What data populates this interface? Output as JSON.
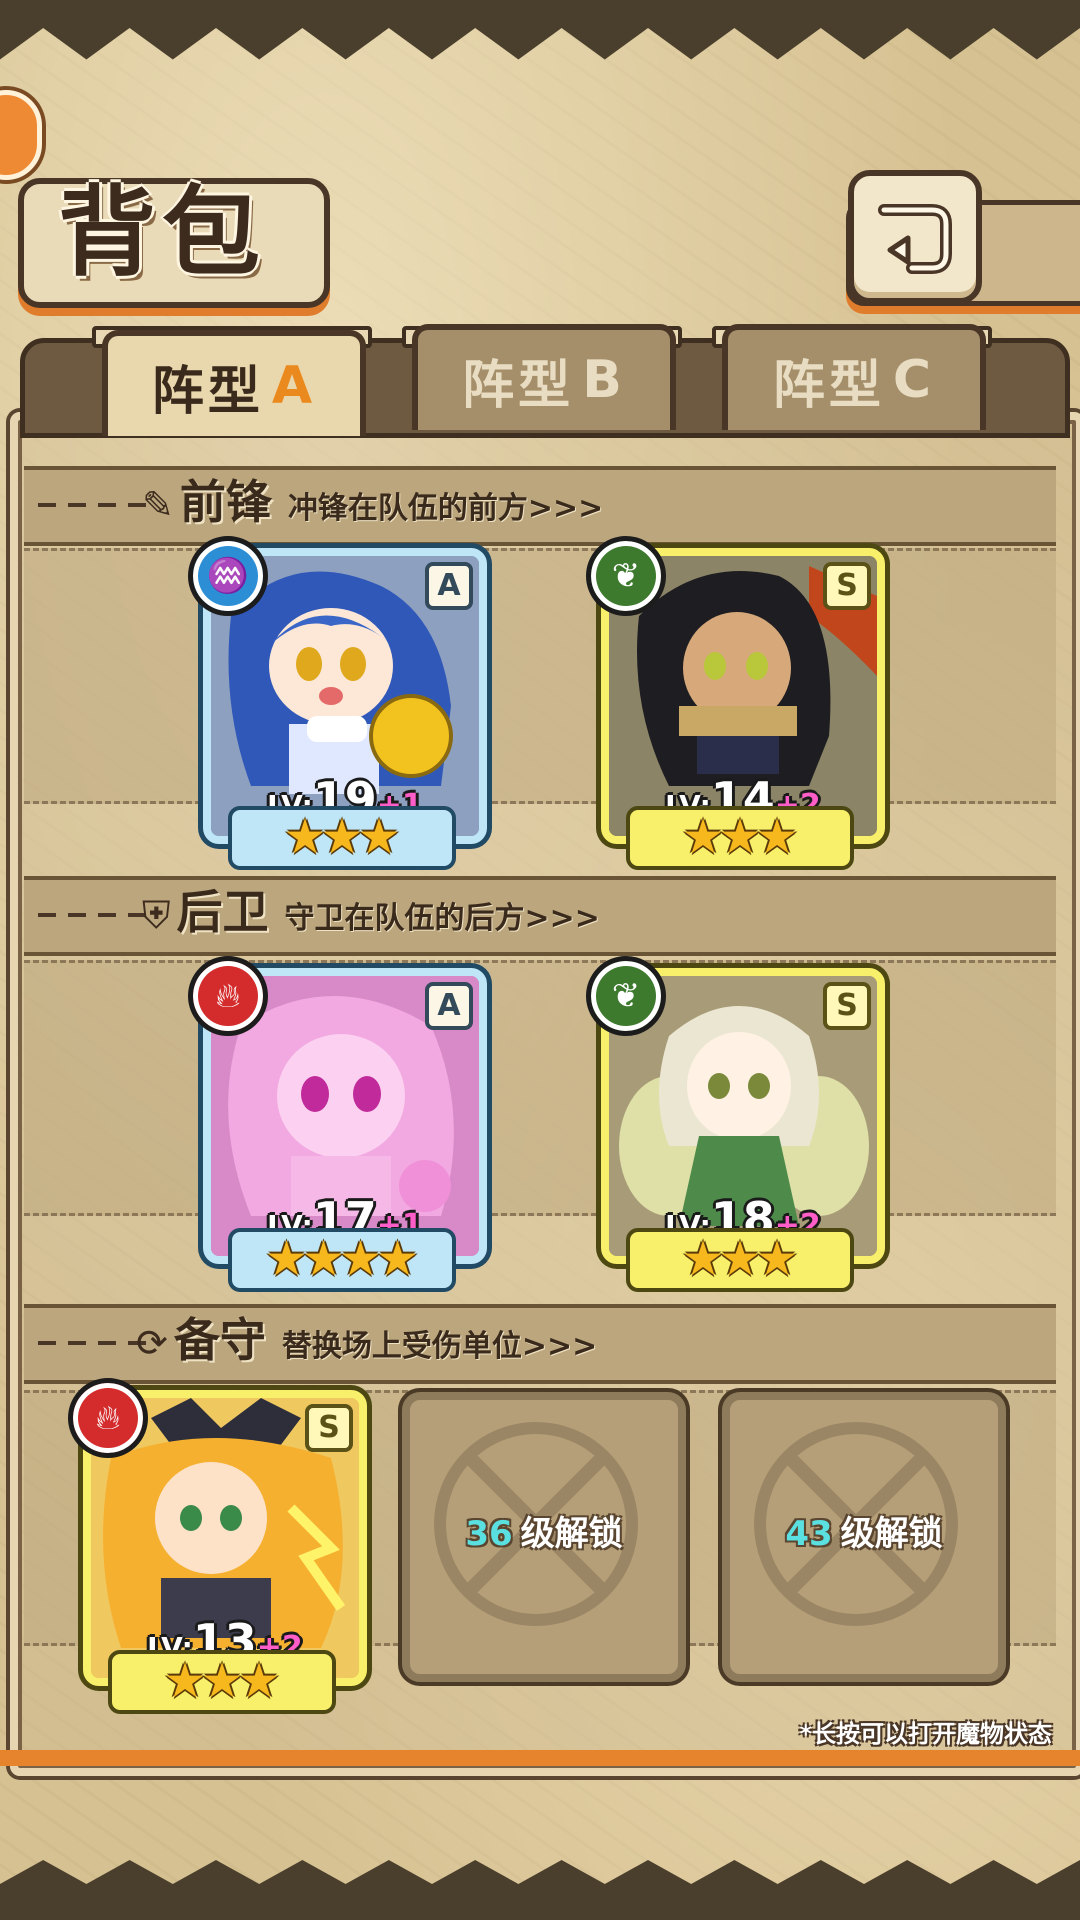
{
  "header": {
    "title": "背包",
    "back_icon": "return-arrow-icon"
  },
  "tabs": [
    {
      "label": "阵型",
      "letter": "A",
      "active": true
    },
    {
      "label": "阵型",
      "letter": "B",
      "active": false
    },
    {
      "label": "阵型",
      "letter": "C",
      "active": false
    }
  ],
  "sections": {
    "front": {
      "icon": "feather-icon",
      "title": "前锋",
      "desc": "冲锋在队伍的前方>>>"
    },
    "back": {
      "icon": "shield-icon",
      "title": "后卫",
      "desc": "守卫在队伍的后方>>>"
    },
    "reserve": {
      "icon": "swap-icon",
      "title": "备守",
      "desc": "替换场上受伤单位>>>"
    }
  },
  "units": [
    {
      "rank": "A",
      "element": "water",
      "lv_prefix": "LV:",
      "level": "19",
      "bonus": "+1",
      "stars": 3,
      "frame_color": "#bfe6f6"
    },
    {
      "rank": "S",
      "element": "grass",
      "lv_prefix": "LV:",
      "level": "14",
      "bonus": "+2",
      "stars": 3,
      "frame_color": "#f8ef6a"
    },
    {
      "rank": "A",
      "element": "fire",
      "lv_prefix": "LV:",
      "level": "17",
      "bonus": "+1",
      "stars": 4,
      "frame_color": "#bfe6f6"
    },
    {
      "rank": "S",
      "element": "grass",
      "lv_prefix": "LV:",
      "level": "18",
      "bonus": "+2",
      "stars": 3,
      "frame_color": "#f8ef6a"
    },
    {
      "rank": "S",
      "element": "fire",
      "lv_prefix": "LV:",
      "level": "13",
      "bonus": "+2",
      "stars": 3,
      "frame_color": "#f8ef6a"
    }
  ],
  "locked_slots": [
    {
      "level": "36",
      "suffix": "级解锁"
    },
    {
      "level": "43",
      "suffix": "级解锁"
    }
  ],
  "footer": {
    "hint": "*长按可以打开魔物状态"
  }
}
